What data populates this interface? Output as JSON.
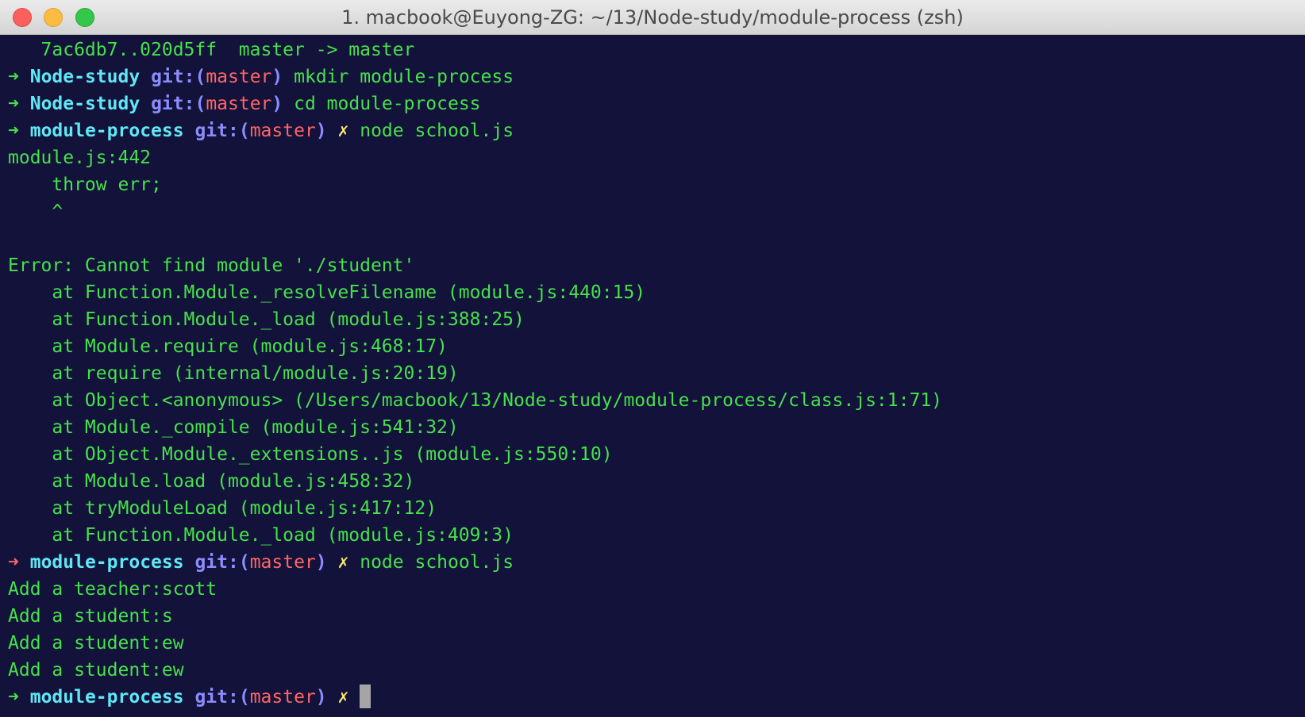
{
  "window": {
    "title": "1. macbook@Euyong-ZG: ~/13/Node-study/module-process (zsh)"
  },
  "terminal": {
    "lines": [
      {
        "type": "output",
        "text": "   7ac6db7..020d5ff  master -> master"
      },
      {
        "type": "prompt",
        "arrow": "➜",
        "status": "ok",
        "dir": "Node-study",
        "git_prefix": "git:(",
        "branch": "master",
        "git_suffix": ")",
        "dirty": "",
        "command": "mkdir module-process"
      },
      {
        "type": "prompt",
        "arrow": "➜",
        "status": "ok",
        "dir": "Node-study",
        "git_prefix": "git:(",
        "branch": "master",
        "git_suffix": ")",
        "dirty": "",
        "command": "cd module-process"
      },
      {
        "type": "prompt",
        "arrow": "➜",
        "status": "ok",
        "dir": "module-process",
        "git_prefix": "git:(",
        "branch": "master",
        "git_suffix": ")",
        "dirty": "✗",
        "command": "node school.js"
      },
      {
        "type": "output",
        "text": "module.js:442"
      },
      {
        "type": "output",
        "text": "    throw err;"
      },
      {
        "type": "output",
        "text": "    ^"
      },
      {
        "type": "output",
        "text": ""
      },
      {
        "type": "output",
        "text": "Error: Cannot find module './student'"
      },
      {
        "type": "output",
        "text": "    at Function.Module._resolveFilename (module.js:440:15)"
      },
      {
        "type": "output",
        "text": "    at Function.Module._load (module.js:388:25)"
      },
      {
        "type": "output",
        "text": "    at Module.require (module.js:468:17)"
      },
      {
        "type": "output",
        "text": "    at require (internal/module.js:20:19)"
      },
      {
        "type": "output",
        "text": "    at Object.<anonymous> (/Users/macbook/13/Node-study/module-process/class.js:1:71)"
      },
      {
        "type": "output",
        "text": "    at Module._compile (module.js:541:32)"
      },
      {
        "type": "output",
        "text": "    at Object.Module._extensions..js (module.js:550:10)"
      },
      {
        "type": "output",
        "text": "    at Module.load (module.js:458:32)"
      },
      {
        "type": "output",
        "text": "    at tryModuleLoad (module.js:417:12)"
      },
      {
        "type": "output",
        "text": "    at Function.Module._load (module.js:409:3)"
      },
      {
        "type": "prompt",
        "arrow": "➜",
        "status": "error",
        "dir": "module-process",
        "git_prefix": "git:(",
        "branch": "master",
        "git_suffix": ")",
        "dirty": "✗",
        "command": "node school.js"
      },
      {
        "type": "output",
        "text": "Add a teacher:scott"
      },
      {
        "type": "output",
        "text": "Add a student:s"
      },
      {
        "type": "output",
        "text": "Add a student:ew"
      },
      {
        "type": "output",
        "text": "Add a student:ew"
      },
      {
        "type": "prompt",
        "arrow": "➜",
        "status": "ok",
        "dir": "module-process",
        "git_prefix": "git:(",
        "branch": "master",
        "git_suffix": ")",
        "dirty": "✗",
        "command": "",
        "cursor": true
      }
    ]
  },
  "colors": {
    "background": "#12123a",
    "output": "#47e14b",
    "arrow_ok": "#46e04a",
    "arrow_error": "#ff6565",
    "directory": "#5fe7f5",
    "git": "#8c8cff",
    "branch": "#ff6565",
    "dirty": "#f5e86d"
  }
}
